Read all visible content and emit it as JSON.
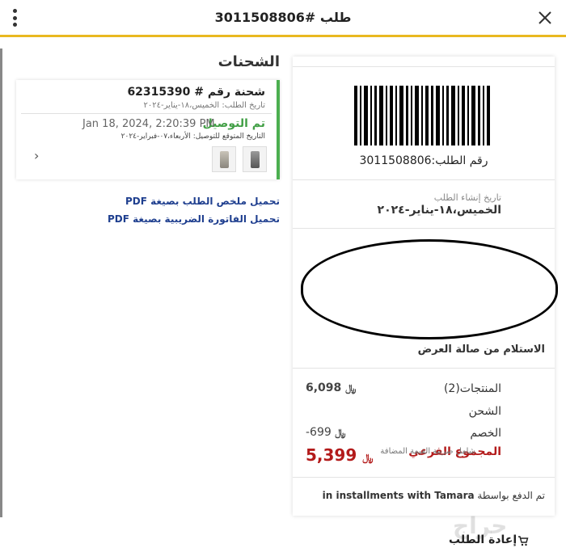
{
  "header": {
    "title": "طلب #3011508806"
  },
  "shipments": {
    "title": "الشحنات",
    "card": {
      "number": "شحنة رقم # 62315390",
      "order_date": "تاريخ الطلب: الخميس،١٨-يناير-٢٠٢٤",
      "status": "تم التوصيل",
      "status_date": "Jan 18, 2024, 2:20:39 PM",
      "expected": "التاريخ المتوقع للتوصيل: الأربعاء،٠٧-فبراير-٢٠٢٤"
    }
  },
  "downloads": {
    "summary_pdf": "تحميل ملخص الطلب بصيغة PDF",
    "invoice_pdf": "تحميل الفاتورة الضريبية بصيغة PDF"
  },
  "order": {
    "number_label": "رقم الطلب:3011508806",
    "created_label": "تاريخ إنشاء الطلب",
    "created_value": "الخميس،١٨-يناير-٢٠٢٤",
    "pickup": "الاستلام من صالة العرض"
  },
  "summary": {
    "products_label": "المنتجات(2)",
    "products_value": "6,098",
    "shipping_label": "الشحن",
    "discount_label": "الخصم",
    "discount_value": "-699",
    "subtotal_label": "المجموع الفرعي",
    "vat_note": "شامل ضريبة القيمة المضافة",
    "subtotal_value": "5,399",
    "currency": "﷼"
  },
  "payment": {
    "prefix": "تم الدفع بواسطة",
    "method": "in installments with Tamara"
  },
  "actions": {
    "reorder": "إعادة الطلب"
  },
  "watermark": "حراج",
  "colors": {
    "accent_yellow": "#e9b820",
    "delivered_green": "#43a047",
    "link_blue": "#1f3f8f",
    "subtotal_red": "#b31b1b"
  }
}
